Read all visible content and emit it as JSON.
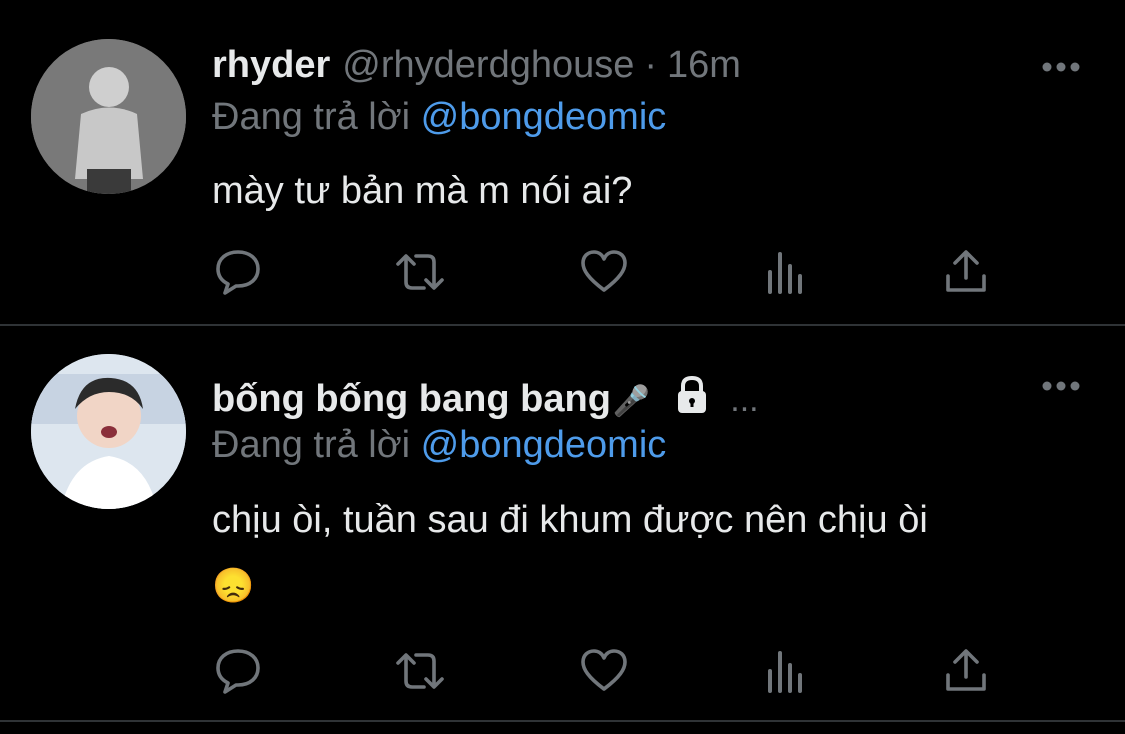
{
  "tweets": [
    {
      "display_name": "rhyder",
      "handle": "@rhyderdghouse",
      "separator": "·",
      "time": "16m",
      "reply_prefix": "Đang trả lời",
      "reply_to": "@bongdeomic",
      "text_lines": [
        "mày tư bản mà m nói ai?"
      ],
      "icons": [
        "reply-icon",
        "retweet-icon",
        "like-icon",
        "views-icon",
        "share-icon",
        "more-icon"
      ]
    },
    {
      "display_name": "bống bống bang bang",
      "name_emoji": "🎤",
      "truncation": "...",
      "reply_prefix": "Đang trả lời",
      "reply_to": "@bongdeomic",
      "text_lines": [
        "chịu òi, tuần sau đi khum được nên chịu òi",
        "😞"
      ],
      "icons": [
        "lock-icon",
        "reply-icon",
        "retweet-icon",
        "like-icon",
        "views-icon",
        "share-icon",
        "more-icon"
      ]
    }
  ],
  "colors": {
    "background": "#000000",
    "text": "#e7e9ea",
    "secondary": "#71767b",
    "mention": "#4e9bea",
    "divider": "#2f3336"
  }
}
